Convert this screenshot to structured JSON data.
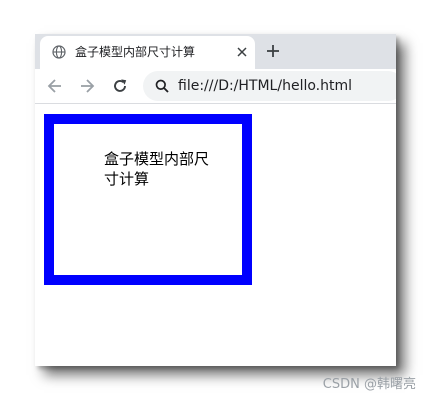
{
  "browser": {
    "tab": {
      "title": "盒子模型内部尺寸计算",
      "favicon_icon": "globe-icon",
      "close_icon": "close-icon"
    },
    "new_tab_icon": "plus-icon",
    "toolbar": {
      "back_icon": "arrow-left-icon",
      "forward_icon": "arrow-right-icon",
      "reload_icon": "reload-icon",
      "search_icon": "search-icon",
      "url": "file:///D:/HTML/hello.html"
    }
  },
  "page": {
    "box_text": "盒子模型内部尺寸计算",
    "box_border_color": "#0000ff"
  },
  "watermark": "CSDN @韩曙亮"
}
